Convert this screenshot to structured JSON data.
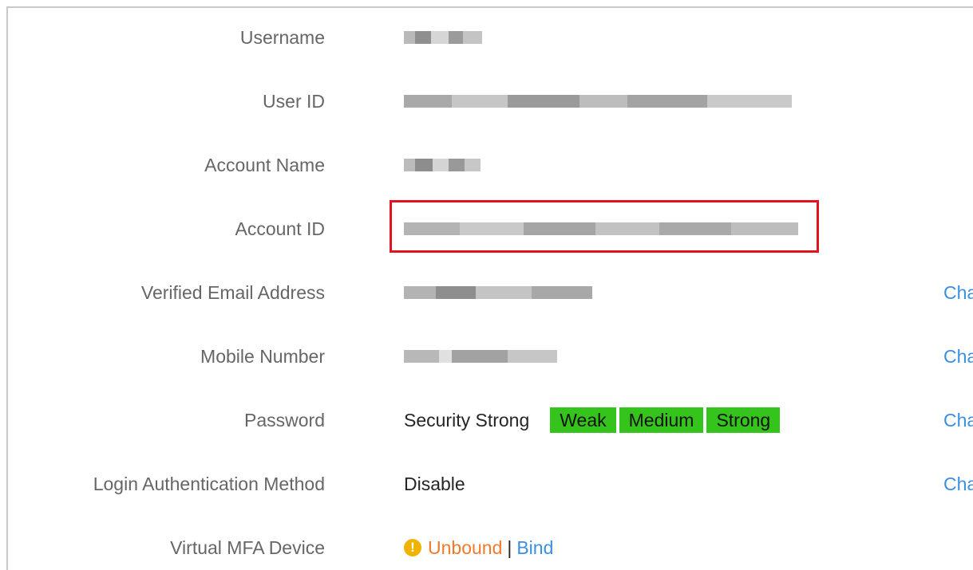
{
  "rows": [
    {
      "label": "Username"
    },
    {
      "label": "User ID"
    },
    {
      "label": "Account Name"
    },
    {
      "label": "Account ID"
    },
    {
      "label": "Verified Email Address",
      "action": "Cha"
    },
    {
      "label": "Mobile Number",
      "action": "Cha"
    },
    {
      "label": "Password",
      "value": "Security Strong",
      "action": "Cha"
    },
    {
      "label": "Login Authentication Method",
      "value": "Disable",
      "action": "Cha"
    },
    {
      "label": "Virtual MFA Device"
    }
  ],
  "password_strength": {
    "levels": [
      "Weak",
      "Medium",
      "Strong"
    ],
    "color": "#35c41c"
  },
  "mfa": {
    "status": "Unbound",
    "separator": "|",
    "bind_label": "Bind",
    "status_color": "#ee7a2c",
    "link_color": "#3b8fe0",
    "icon": "warning-icon"
  },
  "colors": {
    "label": "#666666",
    "value": "#252525",
    "link": "#3b8fe0",
    "highlight_border": "#e0141e"
  }
}
